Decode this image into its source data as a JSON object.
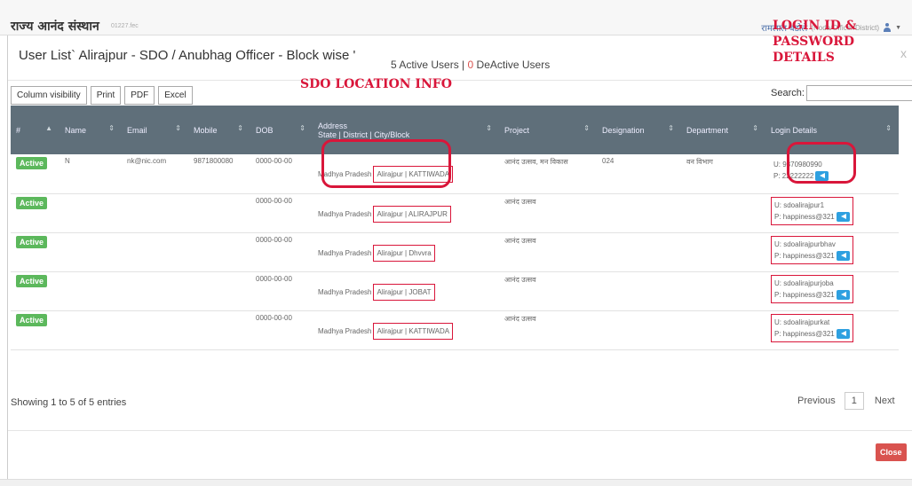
{
  "header": {
    "brand": "राज्य आनंद संस्थान",
    "brand_small": "01227.fec",
    "user_name": "रामलाल बडोले",
    "user_role": "(Noda/Officer/District)"
  },
  "modal": {
    "title": "User List` Alirajpur - SDO / Anubhag Officer - Block wise '",
    "close_symbol": "x",
    "counts_active": "5 Active Users |",
    "counts_inactive": "0",
    "counts_suffix": "DeActive Users"
  },
  "annotations": {
    "login": "LOGIN ID & PASSWORD DETAILS",
    "sdo": "SDO LOCATION INFO"
  },
  "toolbar": {
    "buttons": [
      "Column visibility",
      "Print",
      "PDF",
      "Excel"
    ],
    "search_label": "Search:"
  },
  "table": {
    "headers": [
      "#",
      "Name",
      "Email",
      "Mobile",
      "DOB",
      "Address",
      "State | District | City/Block",
      "Project",
      "Designation",
      "Department",
      "Login Details"
    ],
    "rows": [
      {
        "status": "Active",
        "name": "N",
        "email": "nk@nic.com",
        "mobile": "9871800080",
        "dob": "0000-00-00",
        "state": "Madhya Pradesh",
        "location": "Alirajpur | KATTIWADA",
        "project": "आनंद उत्सव, मन विकास",
        "designation": "024",
        "department": "वन विभाग",
        "user": "U: 9870980990",
        "pass": "P: 22222222"
      },
      {
        "status": "Active",
        "name": "",
        "email": "",
        "mobile": "",
        "dob": "0000-00-00",
        "state": "Madhya Pradesh",
        "location": "Alirajpur | ALIRAJPUR",
        "project": "आनंद उत्सव",
        "designation": "",
        "department": "",
        "user": "U: sdoalirajpur1",
        "pass": "P: happiness@321"
      },
      {
        "status": "Active",
        "name": "",
        "email": "",
        "mobile": "",
        "dob": "0000-00-00",
        "state": "Madhya Pradesh",
        "location": "Alirajpur | Dhvvra",
        "project": "आनंद उत्सव",
        "designation": "",
        "department": "",
        "user": "U: sdoalirajpurbhav",
        "pass": "P: happiness@321"
      },
      {
        "status": "Active",
        "name": "",
        "email": "",
        "mobile": "",
        "dob": "0000-00-00",
        "state": "Madhya Pradesh",
        "location": "Alirajpur | JOBAT",
        "project": "आनंद उत्सव",
        "designation": "",
        "department": "",
        "user": "U: sdoalirajpurjoba",
        "pass": "P: happiness@321"
      },
      {
        "status": "Active",
        "name": "",
        "email": "",
        "mobile": "",
        "dob": "0000-00-00",
        "state": "Madhya Pradesh",
        "location": "Alirajpur | KATTIWADA",
        "project": "आनंद उत्सव",
        "designation": "",
        "department": "",
        "user": "U: sdoalirajpurkat",
        "pass": "P: happiness@321"
      }
    ]
  },
  "footer": {
    "showing": "Showing 1 to 5 of 5 entries",
    "previous": "Previous",
    "page": "1",
    "next": "Next",
    "close": "Close"
  }
}
